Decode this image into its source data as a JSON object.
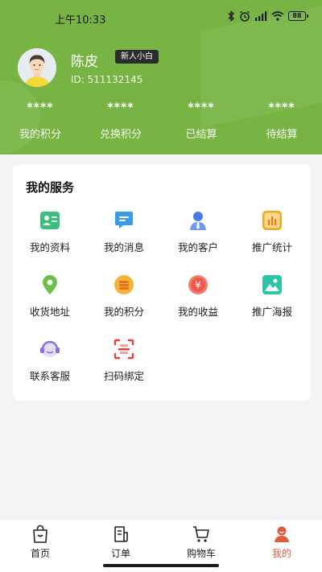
{
  "status_bar": {
    "time": "上午10:33",
    "battery": "88"
  },
  "profile": {
    "name": "陈皮",
    "badge": "新人小白",
    "id_text": "ID: 511132145"
  },
  "stats": [
    {
      "value": "****",
      "label": "我的积分"
    },
    {
      "value": "****",
      "label": "兑换积分"
    },
    {
      "value": "****",
      "label": "已结算"
    },
    {
      "value": "****",
      "label": "待结算"
    }
  ],
  "services": {
    "title": "我的服务",
    "items": [
      {
        "label": "我的资料",
        "icon": "profile-card-icon",
        "color": "#3bbf7a"
      },
      {
        "label": "我的消息",
        "icon": "message-icon",
        "color": "#3a9be8"
      },
      {
        "label": "我的客户",
        "icon": "customer-icon",
        "color": "#4a7de0"
      },
      {
        "label": "推广统计",
        "icon": "stats-chart-icon",
        "color": "#f4a623"
      },
      {
        "label": "收货地址",
        "icon": "location-pin-icon",
        "color": "#6cc04a"
      },
      {
        "label": "我的积分",
        "icon": "coins-icon",
        "color": "#f4a030"
      },
      {
        "label": "我的收益",
        "icon": "yen-coin-icon",
        "color": "#ee5a4a"
      },
      {
        "label": "推广海报",
        "icon": "poster-image-icon",
        "color": "#2fc4a8"
      },
      {
        "label": "联系客服",
        "icon": "customer-service-icon",
        "color": "#8a6fe0"
      },
      {
        "label": "扫码绑定",
        "icon": "scan-icon",
        "color": "#e0463a"
      }
    ]
  },
  "tabbar": [
    {
      "label": "首页",
      "icon": "home-bag-icon"
    },
    {
      "label": "订单",
      "icon": "order-icon"
    },
    {
      "label": "购物车",
      "icon": "cart-icon"
    },
    {
      "label": "我的",
      "icon": "profile-icon",
      "active": true
    }
  ],
  "colors": {
    "header": "#77b443",
    "accent": "#e05a3c"
  }
}
